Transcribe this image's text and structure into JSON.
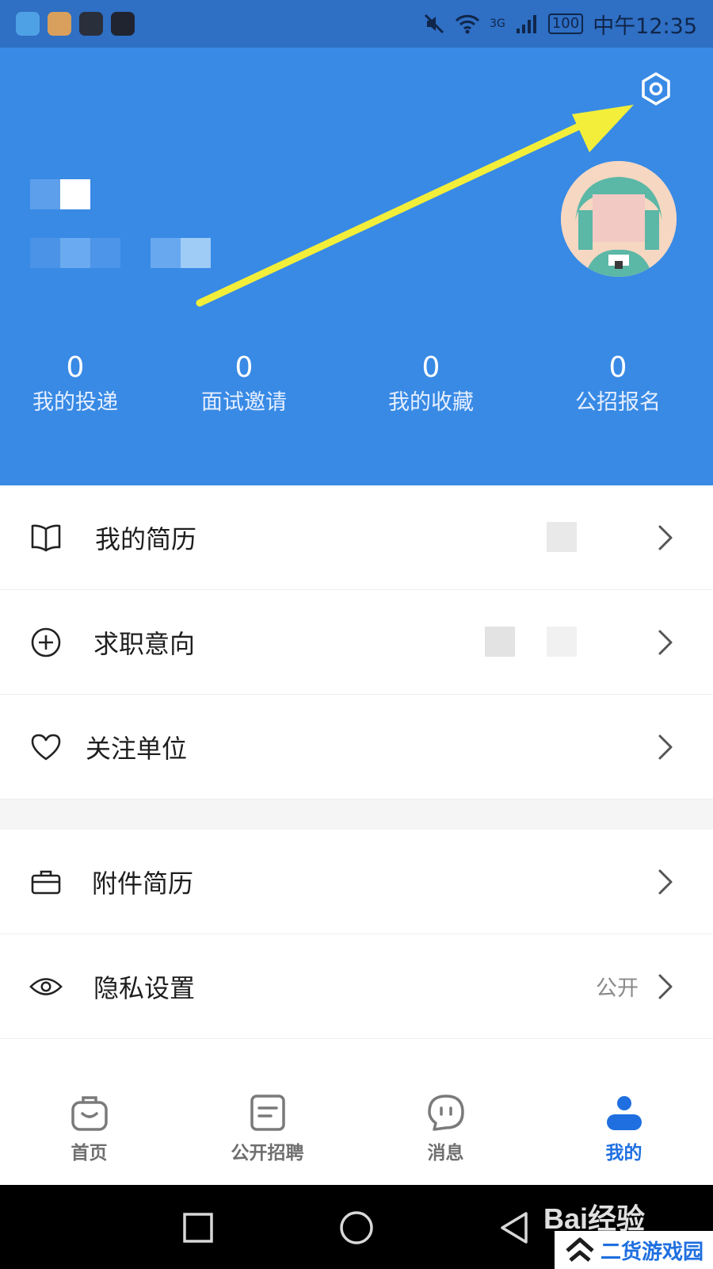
{
  "status_bar": {
    "battery": "100",
    "network": "3G",
    "time": "中午12:35"
  },
  "header": {
    "stats": [
      {
        "value": "0",
        "label": "我的投递"
      },
      {
        "value": "0",
        "label": "面试邀请"
      },
      {
        "value": "0",
        "label": "我的收藏"
      },
      {
        "value": "0",
        "label": "公招报名"
      }
    ]
  },
  "menu": {
    "items": [
      {
        "label": "我的简历"
      },
      {
        "label": "求职意向"
      },
      {
        "label": "关注单位"
      },
      {
        "label": "附件简历"
      },
      {
        "label": "隐私设置",
        "value": "公开"
      }
    ]
  },
  "bottom_nav": {
    "items": [
      {
        "label": "首页"
      },
      {
        "label": "公开招聘"
      },
      {
        "label": "消息"
      },
      {
        "label": "我的"
      }
    ],
    "active": "我的"
  },
  "watermark": {
    "brand": "Bai经验",
    "site": "二货游戏园"
  },
  "colors": {
    "header_bg": "#388ae5",
    "accent": "#1f6fe0",
    "arrow": "#f2ee3a"
  }
}
